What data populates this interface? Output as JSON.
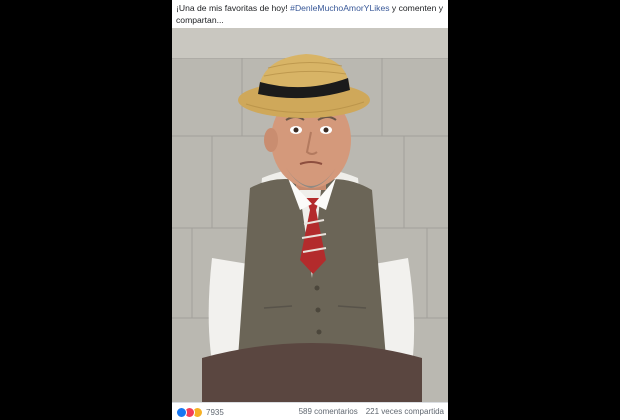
{
  "post": {
    "caption_prefix": "¡Una de mis favoritas de hoy! ",
    "hashtag": "#DenleMuchoAmorYLikes",
    "caption_suffix": " y comenten y compartan...",
    "reactions": {
      "icons": [
        "like-icon",
        "love-icon",
        "haha-icon"
      ],
      "count": "7935"
    },
    "comments": "589 comentarios",
    "shares": "221 veces compartida"
  },
  "colors": {
    "background": "#000000",
    "card": "#ffffff",
    "hashtag": "#385898",
    "like": "#1877f2",
    "love": "#f33e58",
    "haha": "#f7b125"
  }
}
